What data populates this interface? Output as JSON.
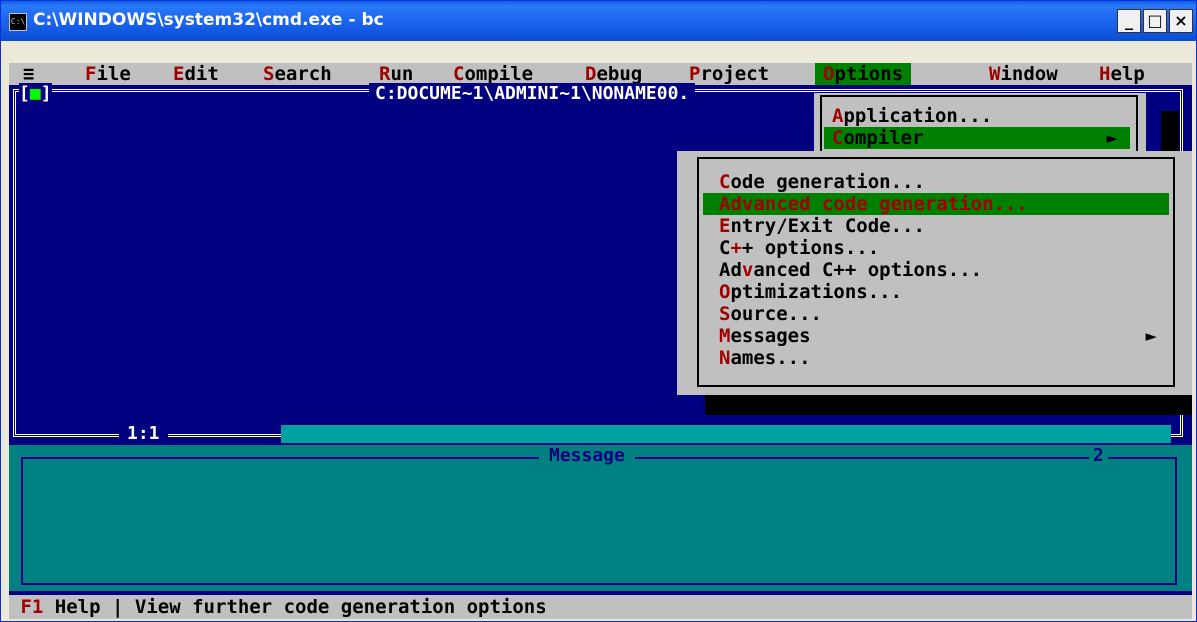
{
  "window": {
    "title": "C:\\WINDOWS\\system32\\cmd.exe - bc",
    "icon_text": "C:\\",
    "controls": {
      "minimize": "_",
      "maximize": "□",
      "close": "×"
    }
  },
  "menubar": {
    "system": "≡",
    "items": [
      {
        "hotkey": "F",
        "rest": "ile"
      },
      {
        "hotkey": "E",
        "rest": "dit"
      },
      {
        "hotkey": "S",
        "rest": "earch"
      },
      {
        "hotkey": "R",
        "rest": "un"
      },
      {
        "hotkey": "C",
        "rest": "ompile"
      },
      {
        "hotkey": "D",
        "rest": "ebug"
      },
      {
        "hotkey": "P",
        "rest": "roject"
      },
      {
        "hotkey": "O",
        "rest": "ptions"
      },
      {
        "hotkey": "W",
        "rest": "indow"
      },
      {
        "hotkey": "H",
        "rest": "elp"
      }
    ]
  },
  "editor": {
    "close_box_left": "[",
    "close_box_mid": "■",
    "close_box_right": "]",
    "file_title": "C:DOCUME~1\\ADMINI~1\\NONAME00.",
    "cursor_pos": "1:1"
  },
  "options_menu": {
    "items": [
      {
        "hotkey": "A",
        "rest": "pplication..."
      },
      {
        "hotkey": "C",
        "rest": "ompiler",
        "arrow": "►"
      }
    ]
  },
  "compiler_submenu": {
    "items": [
      {
        "hotkey": "C",
        "rest": "ode generation..."
      },
      {
        "hotkey": "A",
        "rest": "dvanced code generation..."
      },
      {
        "hotkey": "E",
        "rest": "ntry/Exit Code..."
      },
      {
        "prefix": "C",
        "hotkey": "+",
        "rest": "+ options..."
      },
      {
        "prefix": "Ad",
        "hotkey": "v",
        "rest": "anced C++ options..."
      },
      {
        "hotkey": "O",
        "rest": "ptimizations..."
      },
      {
        "hotkey": "S",
        "rest": "ource..."
      },
      {
        "hotkey": "M",
        "rest": "essages",
        "arrow": "►"
      },
      {
        "hotkey": "N",
        "rest": "ames..."
      }
    ]
  },
  "message_panel": {
    "title": "Message",
    "number": "2"
  },
  "status_bar": {
    "key": "F1",
    "help": " Help ",
    "separator": "|",
    "text": " View further code generation options"
  }
}
